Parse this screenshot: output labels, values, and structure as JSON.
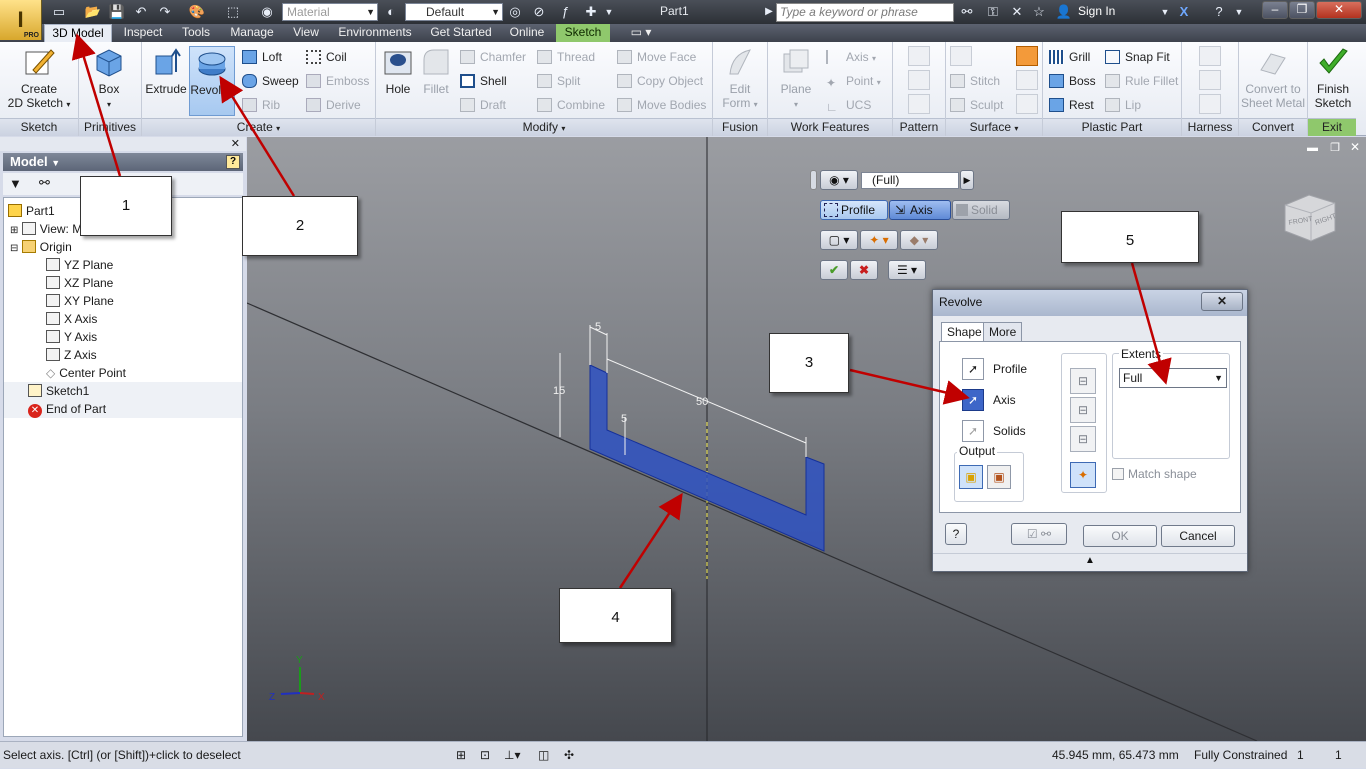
{
  "app": {
    "logo_letter": "I",
    "edition": "PRO",
    "document_title": "Part1"
  },
  "qat": {
    "material_placeholder": "Material",
    "appearance_value": "Default",
    "fx_label": "f x"
  },
  "help_search": {
    "placeholder": "Type a keyword or phrase",
    "signin": "Sign In"
  },
  "tabs": [
    "3D Model",
    "Inspect",
    "Tools",
    "Manage",
    "View",
    "Environments",
    "Get Started",
    "Online",
    "Sketch"
  ],
  "ribbon": {
    "sketch": {
      "create_label": "Create\n2D Sketch",
      "create_line1": "Create",
      "create_line2": "2D Sketch",
      "panel": "Sketch"
    },
    "primitives": {
      "box": "Box",
      "panel": "Primitives"
    },
    "create": {
      "extrude": "Extrude",
      "revolve": "Revolve",
      "loft": "Loft",
      "sweep": "Sweep",
      "rib": "Rib",
      "coil": "Coil",
      "emboss": "Emboss",
      "derive": "Derive",
      "panel": "Create"
    },
    "modify": {
      "hole": "Hole",
      "fillet": "Fillet",
      "chamfer": "Chamfer",
      "shell": "Shell",
      "draft": "Draft",
      "thread": "Thread",
      "split": "Split",
      "combine": "Combine",
      "move_face": "Move Face",
      "copy_object": "Copy Object",
      "move_bodies": "Move Bodies",
      "panel": "Modify"
    },
    "fusion": {
      "edit_form_1": "Edit",
      "edit_form_2": "Form",
      "panel": "Fusion"
    },
    "work_features": {
      "plane": "Plane",
      "axis": "Axis",
      "point": "Point",
      "ucs": "UCS",
      "panel": "Work Features"
    },
    "pattern": {
      "panel": "Pattern"
    },
    "surface": {
      "stitch": "Stitch",
      "sculpt": "Sculpt",
      "panel": "Surface"
    },
    "plastic_part": {
      "grill": "Grill",
      "boss": "Boss",
      "rest": "Rest",
      "snap_fit": "Snap Fit",
      "rule_fillet": "Rule Fillet",
      "lip": "Lip",
      "panel": "Plastic Part"
    },
    "harness": {
      "panel": "Harness"
    },
    "convert": {
      "line1": "Convert to",
      "line2": "Sheet Metal",
      "panel": "Convert"
    },
    "exit": {
      "line1": "Finish",
      "line2": "Sketch",
      "panel": "Exit"
    }
  },
  "browser": {
    "title": "Model",
    "nodes": {
      "part": "Part1",
      "view": "View: M",
      "origin": "Origin",
      "yz": "YZ Plane",
      "xz": "XZ Plane",
      "xy": "XY Plane",
      "xaxis": "X Axis",
      "yaxis": "Y Axis",
      "zaxis": "Z Axis",
      "center": "Center Point",
      "sketch1": "Sketch1",
      "end": "End of Part"
    }
  },
  "minimenu": {
    "extents_value": "(Full)",
    "profile": "Profile",
    "axis": "Axis",
    "solid": "Solid"
  },
  "sketch_dims": {
    "d1": "5",
    "d2": "15",
    "d3": "50",
    "d4": "5"
  },
  "triad": {
    "x": "X",
    "y": "Y",
    "z": "Z"
  },
  "viewcube": {
    "front": "FRONT",
    "right": "RIGHT"
  },
  "dialog": {
    "title": "Revolve",
    "tab_shape": "Shape",
    "tab_more": "More",
    "profile": "Profile",
    "axis": "Axis",
    "solids": "Solids",
    "output": "Output",
    "extents": "Extents",
    "extents_value": "Full",
    "match_shape": "Match shape",
    "ok": "OK",
    "cancel": "Cancel"
  },
  "callouts": [
    "1",
    "2",
    "3",
    "4",
    "5"
  ],
  "status": {
    "prompt": "Select axis. [Ctrl] (or [Shift])+click to deselect",
    "coords": "45.945 mm, 65.473 mm",
    "constraint": "Fully Constrained",
    "n1": "1",
    "n2": "1"
  },
  "colors": {
    "accent": "#c00000",
    "selection_blue": "#1a3fc4",
    "sketch_tab": "#8fc86c"
  }
}
